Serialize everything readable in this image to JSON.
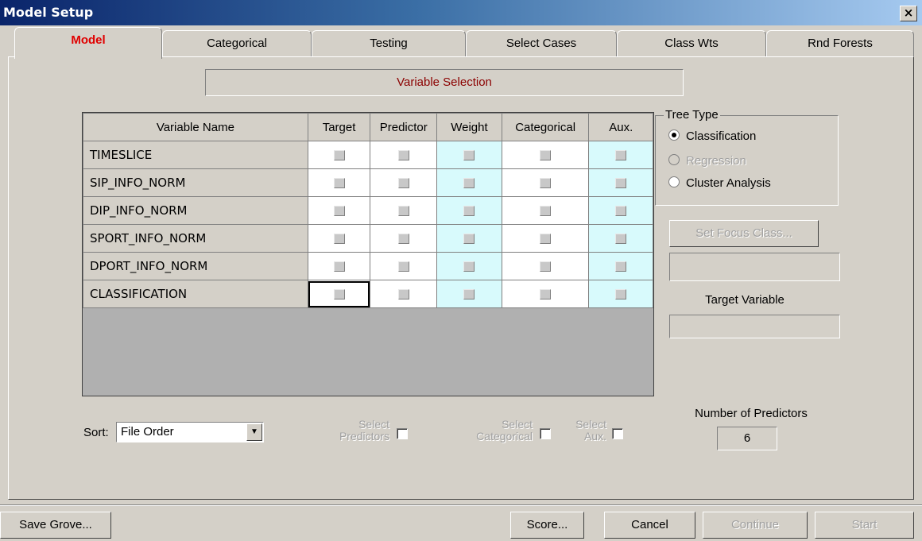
{
  "window": {
    "title": "Model Setup",
    "close_glyph": "×"
  },
  "tabs": [
    {
      "label": "Model",
      "active": true
    },
    {
      "label": "Categorical"
    },
    {
      "label": "Testing"
    },
    {
      "label": "Select Cases"
    },
    {
      "label": "Class Wts",
      "disabled": true
    },
    {
      "label": "Rnd Forests"
    }
  ],
  "variable_selection_label": "Variable Selection",
  "grid": {
    "headers": [
      "Variable Name",
      "Target",
      "Predictor",
      "Weight",
      "Categorical",
      "Aux."
    ],
    "rows": [
      {
        "name": "TIMESLICE"
      },
      {
        "name": "SIP_INFO_NORM"
      },
      {
        "name": "DIP_INFO_NORM"
      },
      {
        "name": "SPORT_INFO_NORM"
      },
      {
        "name": "DPORT_INFO_NORM"
      },
      {
        "name": "CLASSIFICATION"
      }
    ]
  },
  "tree_type": {
    "label": "Tree Type",
    "options": [
      {
        "label": "Classification",
        "selected": true
      },
      {
        "label": "Regression",
        "disabled": true
      },
      {
        "label": "Cluster Analysis"
      }
    ]
  },
  "set_focus_class_label": "Set Focus Class...",
  "target_variable_label": "Target Variable",
  "sort": {
    "label": "Sort:",
    "value": "File Order"
  },
  "select_predictors": {
    "line1": "Select",
    "line2": "Predictors"
  },
  "select_categorical": {
    "line1": "Select",
    "line2": "Categorical"
  },
  "select_aux": {
    "line1": "Select",
    "line2": "Aux."
  },
  "number_of_predictors": {
    "label": "Number of Predictors",
    "value": "6"
  },
  "buttons": {
    "save_grove": "Save Grove...",
    "score": "Score...",
    "cancel": "Cancel",
    "continue": "Continue",
    "start": "Start"
  }
}
